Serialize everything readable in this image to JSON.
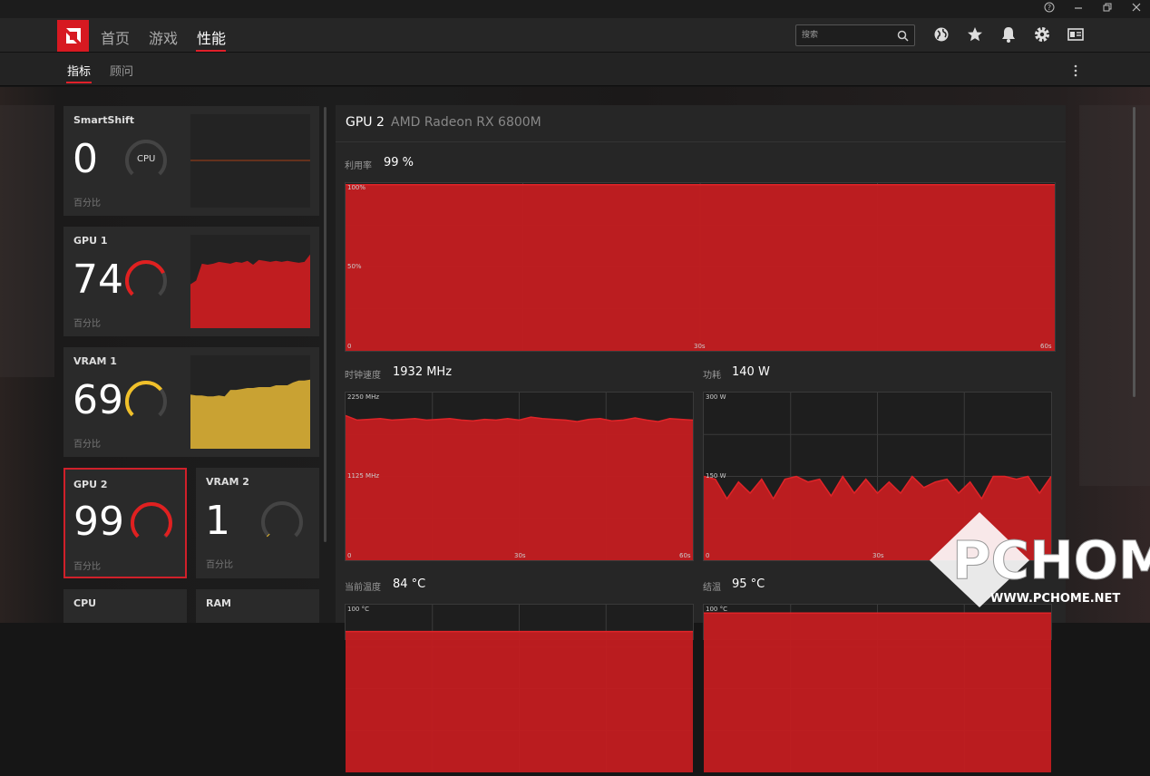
{
  "window": {
    "help_icon": "help-icon",
    "minimize_icon": "minimize-icon",
    "restore_icon": "restore-icon",
    "close_icon": "close-icon"
  },
  "nav": {
    "items": [
      "首页",
      "游戏",
      "性能"
    ],
    "active": "性能"
  },
  "search": {
    "placeholder": "搜索"
  },
  "toolbar": {
    "icons": [
      "globe-icon",
      "star-icon",
      "bell-icon",
      "gear-icon",
      "account-icon"
    ]
  },
  "subnav": {
    "items": [
      "指标",
      "顾问"
    ],
    "active": "指标"
  },
  "sidebar": {
    "cards": [
      {
        "label": "SmartShift",
        "value": "0",
        "unit": "百分比",
        "gauge_label": "CPU",
        "gauge_fraction": 0,
        "color": "#d71921"
      },
      {
        "label": "GPU 1",
        "value": "74",
        "unit": "百分比",
        "gauge_fraction": 0.74,
        "color": "#e02020"
      },
      {
        "label": "VRAM 1",
        "value": "69",
        "unit": "百分比",
        "gauge_fraction": 0.69,
        "color": "#f0c02a"
      },
      {
        "label": "GPU 2",
        "value": "99",
        "unit": "百分比",
        "gauge_fraction": 0.99,
        "color": "#e02020",
        "selected": true
      },
      {
        "label": "VRAM 2",
        "value": "1",
        "unit": "百分比",
        "gauge_fraction": 0.01,
        "color": "#f0c02a"
      },
      {
        "label": "CPU"
      },
      {
        "label": "RAM"
      }
    ],
    "sparklines": {
      "smartshift": [
        0,
        0,
        0,
        0,
        0,
        0,
        0,
        0,
        0,
        0,
        0,
        0,
        0,
        0,
        0,
        0,
        0,
        0,
        0,
        0
      ],
      "gpu1": [
        47,
        51,
        69,
        68,
        69,
        71,
        70,
        69,
        71,
        70,
        72,
        68,
        73,
        72,
        71,
        72,
        71,
        72,
        71,
        70,
        71,
        79
      ],
      "vram1": [
        58,
        57,
        57,
        56,
        56,
        57,
        56,
        63,
        63,
        64,
        65,
        65,
        66,
        66,
        66,
        68,
        68,
        68,
        71,
        73,
        73,
        74
      ]
    }
  },
  "detail": {
    "title": "GPU 2",
    "subtitle": "AMD Radeon RX 6800M",
    "metrics": [
      {
        "label": "利用率",
        "value": "99 %"
      },
      {
        "label": "时钟速度",
        "value": "1932 MHz"
      },
      {
        "label": "功耗",
        "value": "140 W"
      },
      {
        "label": "当前温度",
        "value": "84 °C"
      },
      {
        "label": "结温",
        "value": "95 °C"
      }
    ],
    "axis": {
      "util_top": "100%",
      "util_mid": "50%",
      "clock_top": "2250 MHz",
      "clock_mid": "1125 MHz",
      "power_top": "300 W",
      "power_mid": "150 W",
      "temp_top": "100 °C",
      "x0": "0",
      "x30": "30s",
      "x60": "60s"
    }
  },
  "chart_data": [
    {
      "type": "area",
      "title": "利用率",
      "ylim": [
        0,
        100
      ],
      "values": [
        99,
        99,
        99,
        99,
        99,
        99,
        99,
        99,
        99,
        99,
        99,
        99,
        99,
        99,
        99,
        99,
        99,
        99,
        99,
        99,
        99,
        99,
        99,
        99,
        99,
        99,
        99,
        99,
        99,
        99,
        99
      ]
    },
    {
      "type": "area",
      "title": "时钟速度",
      "ylim": [
        0,
        2250
      ],
      "values": [
        1940,
        1880,
        1890,
        1900,
        1880,
        1890,
        1900,
        1880,
        1890,
        1900,
        1880,
        1870,
        1890,
        1880,
        1900,
        1880,
        1920,
        1900,
        1890,
        1880,
        1860,
        1890,
        1900,
        1870,
        1880,
        1910,
        1880,
        1860,
        1900,
        1890,
        1880
      ]
    },
    {
      "type": "area",
      "title": "功耗",
      "ylim": [
        0,
        300
      ],
      "values": [
        150,
        145,
        110,
        140,
        120,
        145,
        110,
        145,
        150,
        140,
        145,
        115,
        150,
        120,
        145,
        120,
        140,
        120,
        150,
        130,
        140,
        145,
        120,
        140,
        110,
        150,
        150,
        145,
        150,
        120,
        150
      ]
    },
    {
      "type": "area",
      "title": "当前温度",
      "ylim": [
        0,
        100
      ],
      "values": [
        84,
        84,
        84,
        84,
        84,
        84,
        84,
        84,
        84,
        84,
        84,
        84,
        84,
        84,
        84,
        84,
        84,
        84,
        84,
        84,
        84
      ]
    },
    {
      "type": "area",
      "title": "结温",
      "ylim": [
        0,
        100
      ],
      "values": [
        95,
        95,
        95,
        95,
        95,
        95,
        95,
        95,
        95,
        95,
        95,
        95,
        95,
        95,
        95,
        95,
        95,
        95,
        95,
        95,
        95
      ]
    }
  ],
  "watermark": {
    "text": "PCHOME",
    "url": "WWW.PCHOME.NET"
  }
}
